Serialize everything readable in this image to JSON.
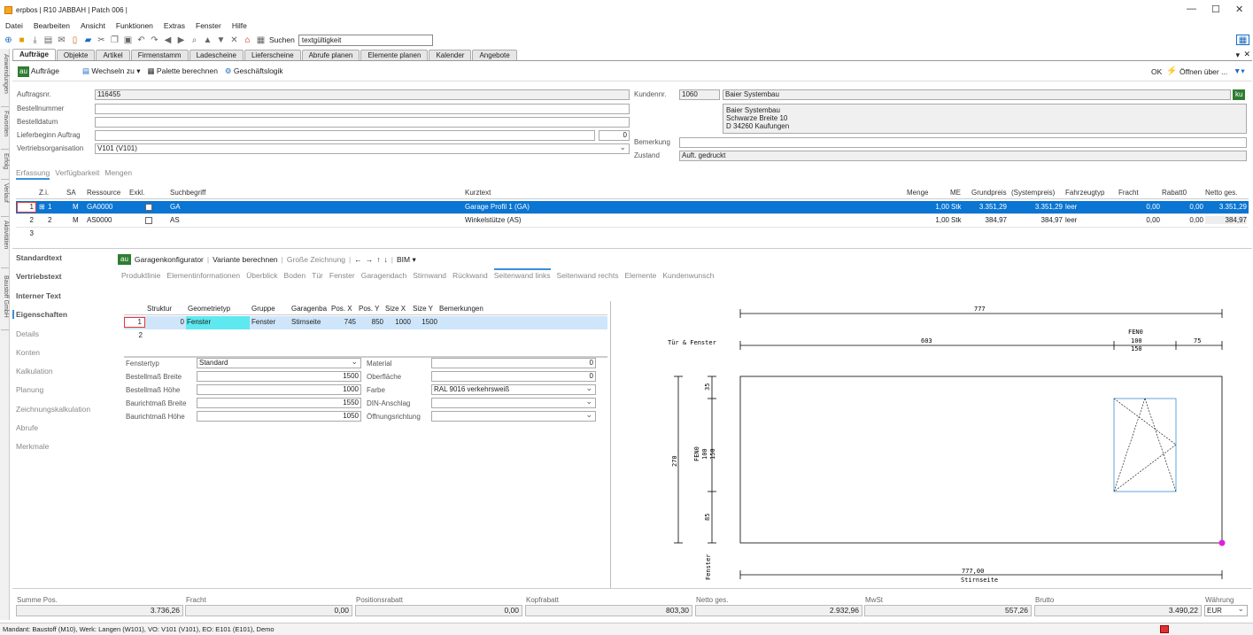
{
  "window": {
    "title": "erpbos | R10 JABBAH | Patch 006 |"
  },
  "menu": [
    "Datei",
    "Bearbeiten",
    "Ansicht",
    "Funktionen",
    "Extras",
    "Fenster",
    "Hilfe"
  ],
  "toolbar": {
    "search_label": "Suchen",
    "search_value": "textgültigkeit"
  },
  "side_tabs": [
    "Anwendungen",
    "Favoriten",
    "Erfolg",
    "Verlauf",
    "Aktivitäten",
    "Baustoff GmbH"
  ],
  "tabs": [
    "Aufträge",
    "Objekte",
    "Artikel",
    "Firmenstamm",
    "Ladescheine",
    "Lieferscheine",
    "Abrufe planen",
    "Elemente planen",
    "Kalender",
    "Angebote"
  ],
  "actions": {
    "module_badge": "au",
    "module": "Aufträge",
    "switch": "Wechseln zu",
    "palette": "Palette berechnen",
    "logic": "Geschäftslogik",
    "ok": "OK",
    "open": "Öffnen über ..."
  },
  "header": {
    "order_no_label": "Auftragsnr.",
    "order_no": "116455",
    "order_ref_label": "Bestellnummer",
    "order_date_label": "Bestelldatum",
    "delivery_label": "Lieferbeginn Auftrag",
    "delivery_num": "0",
    "sales_org_label": "Vertriebsorganisation",
    "sales_org": "V101 (V101)",
    "customer_label": "Kundennr.",
    "customer_no": "1060",
    "customer_name": "Baier Systembau",
    "customer_badge": "ku",
    "address_line1": "Baier Systembau",
    "address_line2": "Schwarze Breite 10",
    "address_line3": "D 34260 Kaufungen",
    "remark_label": "Bemerkung",
    "state_label": "Zustand",
    "state": "Auft. gedruckt"
  },
  "subtabs": [
    "Erfassung",
    "Verfügbarkeit",
    "Mengen"
  ],
  "positions": {
    "columns": [
      "Z.i.",
      "SA",
      "Ressource",
      "Exkl.",
      "Suchbegriff",
      "Kurztext",
      "Menge",
      "ME",
      "Grundpreis",
      "(Systempreis)",
      "Fahrzeugtyp",
      "Fracht",
      "Rabatt0",
      "Netto ges."
    ],
    "rows": [
      {
        "nr": "1",
        "zi": "1",
        "sa": "M",
        "res": "GA0000",
        "such": "GA",
        "kurz": "Garage Profil 1 (GA)",
        "menge": "1,00",
        "me": "Stk",
        "grund": "3.351,29",
        "sys": "3.351,29",
        "fzg": "leer",
        "fracht": "0,00",
        "rabatt": "0,00",
        "netto": "3.351,29"
      },
      {
        "nr": "2",
        "zi": "2",
        "sa": "M",
        "res": "AS0000",
        "such": "AS",
        "kurz": "Winkelstütze (AS)",
        "menge": "1,00",
        "me": "Stk",
        "grund": "384,97",
        "sys": "384,97",
        "fzg": "leer",
        "fracht": "0,00",
        "rabatt": "0,00",
        "netto": "384,97"
      },
      {
        "nr": "3"
      }
    ]
  },
  "leftnav": [
    "Standardtext",
    "Vertriebstext",
    "Interner Text",
    "Eigenschaften",
    "Details",
    "Konten",
    "Kalkulation",
    "Planung",
    "Zeichnungskalkulation",
    "Abrufe",
    "Merkmale"
  ],
  "configurator": {
    "badge": "au",
    "title": "Garagenkonfigurator",
    "variant": "Variante berechnen",
    "big_drawing": "Große Zeichnung",
    "bim": "BIM",
    "tabs": [
      "Produktlinie",
      "Elementinformationen",
      "Überblick",
      "Boden",
      "Tür",
      "Fenster",
      "Garagendach",
      "Stirnwand",
      "Rückwand",
      "Seitenwand links",
      "Seitenwand rechts",
      "Elemente",
      "Kundenwunsch"
    ],
    "columns": [
      "Struktur",
      "Geometrietyp",
      "Gruppe",
      "Garagenba",
      "Pos. X",
      "Pos. Y",
      "Size X",
      "Size Y",
      "Bemerkungen"
    ],
    "rows": [
      {
        "nr": "1",
        "struktur": "0",
        "geo": "Fenster",
        "gruppe": "Fenster",
        "garagenba": "Stirnseite",
        "posx": "745",
        "posy": "850",
        "sizex": "1000",
        "sizey": "1500"
      },
      {
        "nr": "2"
      }
    ],
    "props": {
      "fenstertyp_label": "Fenstertyp",
      "fenstertyp": "Standard",
      "breite_label": "Bestellmaß Breite",
      "breite": "1500",
      "hoehe_label": "Bestellmaß Höhe",
      "hoehe": "1000",
      "bbreite_label": "Baurichtmaß Breite",
      "bbreite": "1550",
      "bhoehe_label": "Baurichtmaß Höhe",
      "bhoehe": "1050",
      "material_label": "Material",
      "material": "0",
      "oberflaeche_label": "Oberfläche",
      "oberflaeche": "0",
      "farbe_label": "Farbe",
      "farbe": "RAL 9016 verkehrsweiß",
      "din_label": "DIN-Anschlag",
      "oeffnung_label": "Öffnungsrichtung"
    }
  },
  "drawing": {
    "top_dim": "777",
    "row_label": "Tür & Fenster",
    "seg1": "603",
    "fen_label": "FEN0",
    "seg_fen": "100",
    "seg_fen2": "150",
    "seg3": "75",
    "left_dim": "270",
    "v1": "35",
    "v_fen": "FEN0",
    "v_fen1": "100",
    "v_fen2": "150",
    "v3": "85",
    "bottom_label": "Fenster",
    "bottom_dim": "777,00",
    "bottom_sub": "Stirnseite"
  },
  "footer": {
    "summe_label": "Summe Pos.",
    "summe": "3.736,26",
    "fracht_label": "Fracht",
    "fracht": "0,00",
    "posrabatt_label": "Positionsrabatt",
    "posrabatt": "0,00",
    "kopfrabatt_label": "Kopfrabatt",
    "kopfrabatt": "803,30",
    "netto_label": "Netto ges.",
    "netto": "2.932,96",
    "mwst_label": "MwSt",
    "mwst": "557,26",
    "brutto_label": "Brutto",
    "brutto": "3.490,22",
    "waehrung_label": "Währung",
    "waehrung": "EUR"
  },
  "status": "Mandant: Baustoff (M10),  Werk: Langen (W101),  VO: V101 (V101),  EO: E101 (E101), Demo",
  "colors": {
    "selection": "#0a75d2",
    "accent_green": "#2e7d32",
    "highlight_cyan": "#5ee8f0",
    "marker": "#e020e0"
  }
}
